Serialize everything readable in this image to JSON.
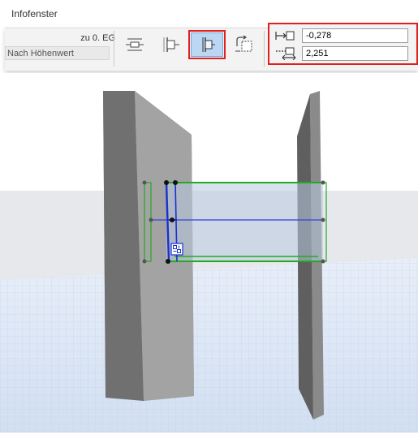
{
  "window": {
    "title": "Infofenster"
  },
  "reference": {
    "story_label": "zu 0. EG",
    "anchor_option": "Nach Höhenwert"
  },
  "toolbar": {
    "buttons": [
      {
        "icon": "offset-left-icon",
        "active": false
      },
      {
        "icon": "align-left-icon",
        "active": false
      },
      {
        "icon": "align-center-icon",
        "active": true
      },
      {
        "icon": "rotate-flip-icon",
        "active": false
      }
    ]
  },
  "coordinates": {
    "offset_value": "-0,278",
    "height_value": "2,251"
  },
  "colors": {
    "highlight": "#e02020",
    "active_button": "#bcd7f3",
    "selection_blue": "#1a2fd0",
    "edit_green": "#22aa22"
  }
}
